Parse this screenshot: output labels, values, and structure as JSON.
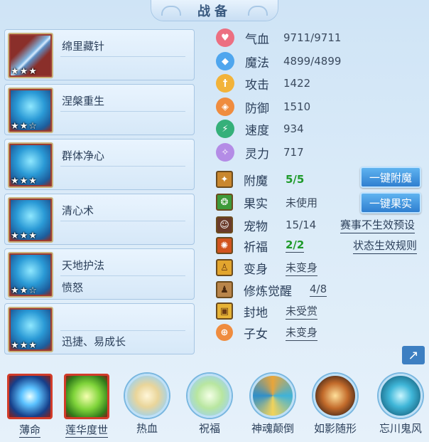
{
  "title": "战备",
  "skills": [
    {
      "name": "绵里藏针",
      "stars": "★★★",
      "sub": ""
    },
    {
      "name": "涅槃重生",
      "stars": "★★☆",
      "sub": ""
    },
    {
      "name": "群体净心",
      "stars": "★★★",
      "sub": ""
    },
    {
      "name": "清心术",
      "stars": "★★★",
      "sub": ""
    },
    {
      "name": "天地护法",
      "stars": "★★☆",
      "sub": "愤怒"
    },
    {
      "name": "",
      "stars": "★★★",
      "sub": "迅捷、易成长"
    }
  ],
  "stats": [
    {
      "label": "气血",
      "value": "9711/9711",
      "icon": "heart-icon",
      "color": "#e9677a"
    },
    {
      "label": "魔法",
      "value": "4899/4899",
      "icon": "mana-icon",
      "color": "#4fa6ee"
    },
    {
      "label": "攻击",
      "value": "1422",
      "icon": "sword-icon",
      "color": "#f2b33a"
    },
    {
      "label": "防御",
      "value": "1510",
      "icon": "shield-icon",
      "color": "#ef8c3f"
    },
    {
      "label": "速度",
      "value": "934",
      "icon": "speed-icon",
      "color": "#35b07a"
    },
    {
      "label": "灵力",
      "value": "717",
      "icon": "spirit-icon",
      "color": "#b48ce6"
    }
  ],
  "extras": [
    {
      "label": "附魔",
      "value": "5/5",
      "icon": "enchant-icon"
    },
    {
      "label": "果实",
      "value": "未使用",
      "icon": "fruit-icon"
    },
    {
      "label": "宠物",
      "value": "15/14",
      "icon": "pet-icon"
    },
    {
      "label": "祈福",
      "value": "2/2",
      "icon": "blessing-icon"
    },
    {
      "label": "变身",
      "value": "未变身",
      "icon": "transform-icon"
    },
    {
      "label": "修炼觉醒",
      "value": "4/8",
      "icon": "cultivation-icon"
    },
    {
      "label": "封地",
      "value": "未受赏",
      "icon": "fief-icon"
    },
    {
      "label": "子女",
      "value": "未变身",
      "icon": "child-icon"
    }
  ],
  "buttons": {
    "enchant": "一键附魔",
    "fruit": "一键果实"
  },
  "links": {
    "preset": "赛事不生效预设",
    "rules": "状态生效规则"
  },
  "bottom": [
    {
      "label": "薄命"
    },
    {
      "label": "莲华度世"
    },
    {
      "label": "热血"
    },
    {
      "label": "祝福"
    },
    {
      "label": "神魂颠倒"
    },
    {
      "label": "如影随形"
    },
    {
      "label": "忘川鬼风"
    }
  ]
}
